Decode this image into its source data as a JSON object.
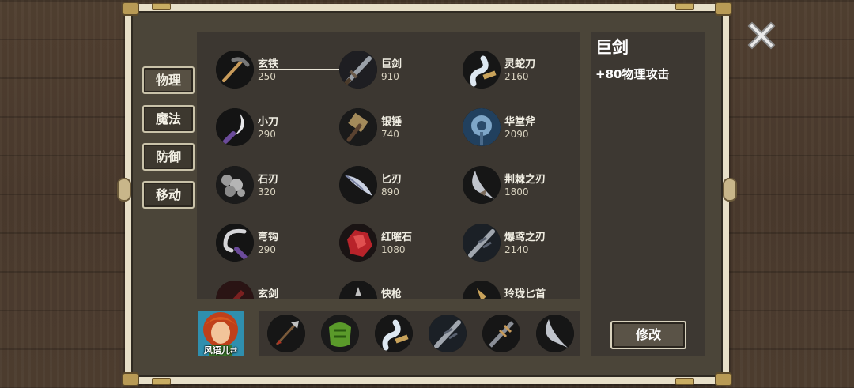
{
  "tabs": [
    {
      "label": "物理",
      "active": true
    },
    {
      "label": "魔法",
      "active": false
    },
    {
      "label": "防御",
      "active": false
    },
    {
      "label": "移动",
      "active": false
    }
  ],
  "items": [
    {
      "name": "玄铁",
      "price": "250",
      "icon": "pickaxe-icon"
    },
    {
      "name": "巨剑",
      "price": "910",
      "icon": "greatsword-icon"
    },
    {
      "name": "灵蛇刀",
      "price": "2160",
      "icon": "serpent-blade-icon"
    },
    {
      "name": "小刀",
      "price": "290",
      "icon": "small-knife-icon"
    },
    {
      "name": "银锤",
      "price": "740",
      "icon": "silver-hammer-icon"
    },
    {
      "name": "华堂斧",
      "price": "2090",
      "icon": "ornate-axe-icon"
    },
    {
      "name": "石刃",
      "price": "320",
      "icon": "stone-blade-icon"
    },
    {
      "name": "匕刃",
      "price": "890",
      "icon": "dagger-blade-icon"
    },
    {
      "name": "荆棘之刃",
      "price": "1800",
      "icon": "thorn-blade-icon"
    },
    {
      "name": "弯钩",
      "price": "290",
      "icon": "hook-icon"
    },
    {
      "name": "红曜石",
      "price": "1080",
      "icon": "red-stone-icon"
    },
    {
      "name": "爆鸢之刃",
      "price": "2140",
      "icon": "kite-blade-icon"
    },
    {
      "name": "玄剑",
      "price": "",
      "icon": "dark-sword-icon"
    },
    {
      "name": "快枪",
      "price": "",
      "icon": "quick-spear-icon"
    },
    {
      "name": "玲珑匕首",
      "price": "",
      "icon": "dainty-dagger-icon"
    }
  ],
  "hero": {
    "name": "风语儿⇄"
  },
  "equipped": [
    {
      "icon": "spear-icon"
    },
    {
      "icon": "green-armor-icon"
    },
    {
      "icon": "serpent-blade-icon"
    },
    {
      "icon": "serrated-sword-icon"
    },
    {
      "icon": "crossbow-blade-icon"
    },
    {
      "icon": "curved-blade-icon"
    }
  ],
  "detail": {
    "title": "巨剑",
    "description": "+80物理攻击"
  },
  "actions": {
    "modify_label": "修改"
  },
  "colors": {
    "panel": "#3c3731",
    "frame": "#e7dfc8",
    "text": "#f0ede2"
  }
}
